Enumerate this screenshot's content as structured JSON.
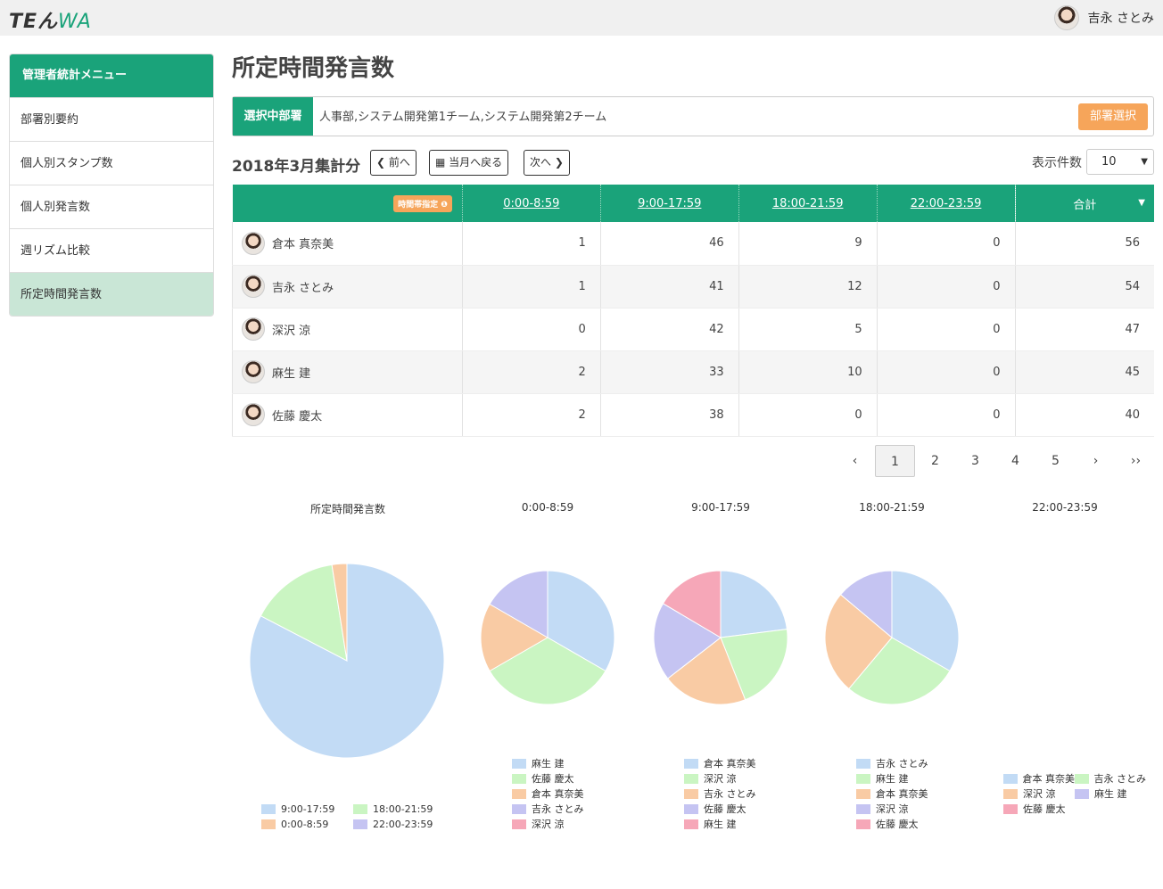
{
  "header": {
    "logo_te": "TEん",
    "logo_wa": "WA",
    "user_name": "吉永 さとみ"
  },
  "sidebar": {
    "title": "管理者統計メニュー",
    "items": [
      {
        "label": "部署別要約"
      },
      {
        "label": "個人別スタンプ数"
      },
      {
        "label": "個人別発言数"
      },
      {
        "label": "週リズム比較"
      },
      {
        "label": "所定時間発言数"
      }
    ]
  },
  "page": {
    "title": "所定時間発言数",
    "dept_label": "選択中部署",
    "dept_value": "人事部,システム開発第1チーム,システム開発第2チーム",
    "dept_button": "部署選択",
    "period": "2018年3月集計分",
    "prev": "前へ",
    "current": "当月へ戻る",
    "next": "次へ",
    "count_label": "表示件数",
    "count_value": "10"
  },
  "table": {
    "time_tag": "時間帯指定",
    "headers": [
      "0:00-8:59",
      "9:00-17:59",
      "18:00-21:59",
      "22:00-23:59",
      "合計"
    ],
    "rows": [
      {
        "name": "倉本 真奈美",
        "values": [
          "1",
          "46",
          "9",
          "0",
          "56"
        ]
      },
      {
        "name": "吉永 さとみ",
        "values": [
          "1",
          "41",
          "12",
          "0",
          "54"
        ]
      },
      {
        "name": "深沢 涼",
        "values": [
          "0",
          "42",
          "5",
          "0",
          "47"
        ]
      },
      {
        "name": "麻生 建",
        "values": [
          "2",
          "33",
          "10",
          "0",
          "45"
        ]
      },
      {
        "name": "佐藤 慶太",
        "values": [
          "2",
          "38",
          "0",
          "0",
          "40"
        ]
      }
    ]
  },
  "pager": [
    "‹",
    "1",
    "2",
    "3",
    "4",
    "5",
    "›",
    "››"
  ],
  "colors": {
    "accent": "#1aa37a",
    "orange": "#f6a55a",
    "pie_blue": "#c2dbf5",
    "pie_green": "#caf5c2",
    "pie_orange": "#f9cba4",
    "pie_purple": "#c5c4f2",
    "pie_pink": "#f6a7b8"
  },
  "chart_data": [
    {
      "type": "pie",
      "title": "所定時間発言数",
      "labels": [
        "9:00-17:59",
        "18:00-21:59",
        "0:00-8:59",
        "22:00-23:59"
      ],
      "values": [
        200,
        36,
        6,
        0
      ]
    },
    {
      "type": "pie",
      "title": "0:00-8:59",
      "labels": [
        "麻生 建",
        "佐藤 慶太",
        "倉本 真奈美",
        "吉永 さとみ",
        "深沢 涼"
      ],
      "values": [
        2,
        2,
        1,
        1,
        0
      ]
    },
    {
      "type": "pie",
      "title": "9:00-17:59",
      "labels": [
        "倉本 真奈美",
        "深沢 涼",
        "吉永 さとみ",
        "佐藤 慶太",
        "麻生 建"
      ],
      "values": [
        46,
        42,
        41,
        38,
        33
      ]
    },
    {
      "type": "pie",
      "title": "18:00-21:59",
      "labels": [
        "吉永 さとみ",
        "麻生 建",
        "倉本 真奈美",
        "深沢 涼",
        "佐藤 慶太"
      ],
      "values": [
        12,
        10,
        9,
        5,
        0
      ]
    },
    {
      "type": "pie",
      "title": "22:00-23:59",
      "labels": [
        "倉本 真奈美",
        "吉永 さとみ",
        "深沢 涼",
        "麻生 建",
        "佐藤 慶太"
      ],
      "values": [
        0,
        0,
        0,
        0,
        0
      ]
    }
  ]
}
